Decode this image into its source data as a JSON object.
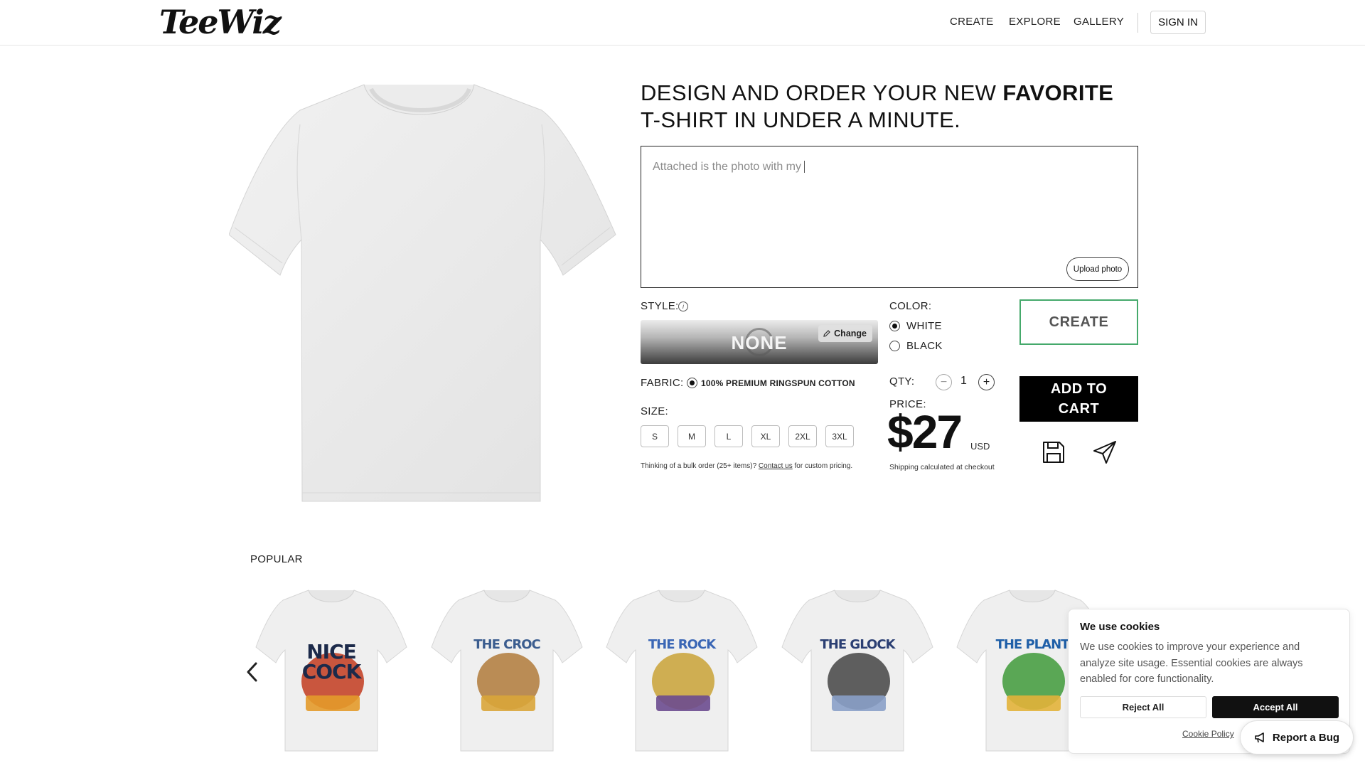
{
  "header": {
    "logo": "TeeWiz",
    "nav": [
      "CREATE",
      "EXPLORE",
      "GALLERY"
    ],
    "sign_in": "SIGN IN"
  },
  "hero": {
    "headline_pre": "DESIGN AND ORDER YOUR NEW",
    "headline_bold": "FAVORITE",
    "headline_line2": "T-SHIRT IN UNDER A MINUTE."
  },
  "prompt": {
    "value": "Attached is the photo with my",
    "upload_label": "Upload photo"
  },
  "style": {
    "label": "STYLE:",
    "value": "NONE",
    "change_label": "Change"
  },
  "fabric": {
    "label": "FABRIC:",
    "value": "100% PREMIUM RINGSPUN COTTON"
  },
  "size": {
    "label": "SIZE:",
    "options": [
      "S",
      "M",
      "L",
      "XL",
      "2XL",
      "3XL"
    ]
  },
  "bulk": {
    "prefix": "Thinking of a bulk order (25+ items)?",
    "link": "Contact us",
    "suffix": "for custom pricing."
  },
  "color": {
    "label": "COLOR:",
    "options": [
      {
        "label": "WHITE",
        "selected": true
      },
      {
        "label": "BLACK",
        "selected": false
      }
    ]
  },
  "qty": {
    "label": "QTY:",
    "value": "1",
    "minus": "−",
    "plus": "+"
  },
  "price": {
    "label": "PRICE:",
    "amount": "$27",
    "currency": "USD",
    "shipping_note": "Shipping calculated at checkout"
  },
  "actions": {
    "create": "CREATE",
    "add_to_cart_line1": "ADD TO",
    "add_to_cart_line2": "CART",
    "save_icon": "floppy-disk-icon",
    "share_icon": "paper-plane-icon"
  },
  "popular": {
    "title": "POPULAR",
    "items": [
      {
        "name": "nice-cock-tee",
        "line1": "NICE",
        "line2": "COCK"
      },
      {
        "name": "the-croc-tee",
        "line1": "THE CROC",
        "line2": ""
      },
      {
        "name": "the-rock-tee",
        "line1": "THE ROCK",
        "line2": ""
      },
      {
        "name": "the-glock-tee",
        "line1": "THE GLOCK",
        "line2": ""
      },
      {
        "name": "the-plant-tee",
        "line1": "THE PLANT",
        "line2": ""
      }
    ]
  },
  "cookies": {
    "title": "We use cookies",
    "text": "We use cookies to improve your experience and analyze site usage. Essential cookies are always enabled for core functionality.",
    "reject": "Reject All",
    "accept": "Accept All",
    "policy": "Cookie Policy"
  },
  "report_bug": "Report a Bug",
  "colors": {
    "create_border": "#45a96b",
    "cart_bg": "#000000"
  }
}
